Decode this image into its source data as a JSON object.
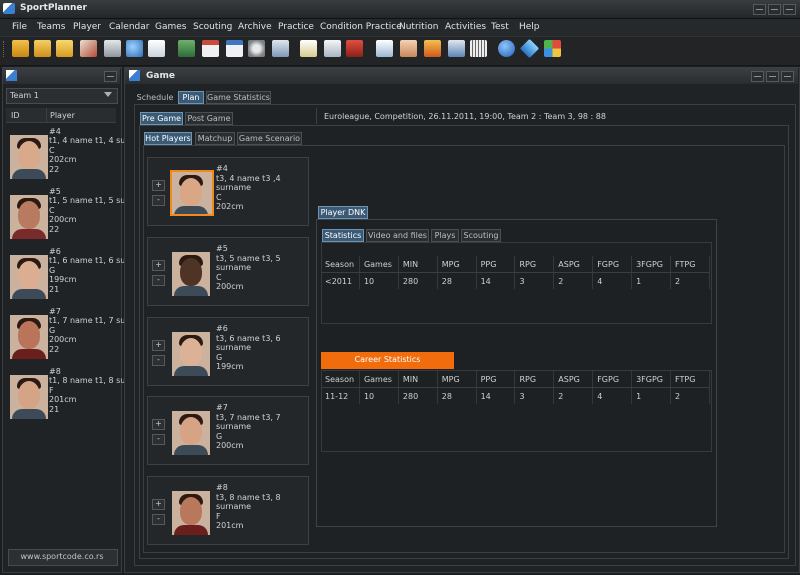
{
  "app": {
    "title": "SportPlanner"
  },
  "menu": [
    "File",
    "Teams",
    "Player",
    "Calendar",
    "Games",
    "Scouting",
    "Archive",
    "Practice",
    "Condition Practice",
    "Nutrition",
    "Activities",
    "Test",
    "Help"
  ],
  "colors": {
    "accent": "#f06c0c",
    "selected_tab": "#3a5a75",
    "background": "#1b1d1e"
  },
  "toolbar_icons": [
    "open-folder-icon",
    "folder-icon",
    "folder-yellow-icon",
    "edit-icon",
    "print-icon",
    "preview-icon",
    "document-icon",
    "image-icon",
    "calendar-icon",
    "calendar-grid-icon",
    "bicycle-icon",
    "keyboard-icon",
    "notes-icon",
    "clipboard-icon",
    "list-icon",
    "checklist-icon",
    "hands-icon",
    "stats-icon",
    "pool-icon",
    "help-icon",
    "diamond-icon",
    "colors-icon"
  ],
  "left": {
    "team_selected": "Team 1",
    "col_id": "ID",
    "col_player": "Player",
    "players": [
      {
        "num": "#4",
        "name": "t1, 4 name t1, 4 su",
        "pos": "C",
        "height": "202cm",
        "age": "22"
      },
      {
        "num": "#5",
        "name": "t1, 5 name t1, 5 su",
        "pos": "C",
        "height": "200cm",
        "age": "22"
      },
      {
        "num": "#6",
        "name": "t1, 6 name t1, 6 su",
        "pos": "G",
        "height": "199cm",
        "age": "21"
      },
      {
        "num": "#7",
        "name": "t1, 7 name t1, 7 su",
        "pos": "G",
        "height": "200cm",
        "age": "22"
      },
      {
        "num": "#8",
        "name": "t1, 8 name t1, 8 su",
        "pos": "F",
        "height": "201cm",
        "age": "21"
      }
    ],
    "footer": "www.sportcode.co.rs"
  },
  "game": {
    "title": "Game",
    "tabs": [
      "Schedule",
      "Plan",
      "Game Statistics"
    ],
    "subtabs": [
      "Pre Game",
      "Post Game"
    ],
    "info": "Euroleague, Competition, 26.11.2011, 19:00, Team 2 :  Team 3, 98 : 88",
    "plan_tabs": [
      "Hot Players",
      "Matchup",
      "Game Scenario"
    ],
    "hot_players": [
      {
        "num": "#4",
        "name": "t3, 4 name t3 ,4",
        "surname": "surname",
        "pos": "C",
        "height": "202cm"
      },
      {
        "num": "#5",
        "name": "t3, 5 name t3, 5",
        "surname": "surname",
        "pos": "C",
        "height": "200cm"
      },
      {
        "num": "#6",
        "name": "t3, 6 name t3, 6",
        "surname": "surname",
        "pos": "G",
        "height": "199cm"
      },
      {
        "num": "#7",
        "name": "t3, 7 name t3, 7",
        "surname": "surname",
        "pos": "G",
        "height": "200cm"
      },
      {
        "num": "#8",
        "name": "t3, 8 name t3, 8",
        "surname": "surname",
        "pos": "F",
        "height": "201cm"
      }
    ],
    "detail": {
      "title": "Player DNK",
      "tabs": [
        "Statistics",
        "Video and files",
        "Plays",
        "Scouting"
      ],
      "columns": [
        "Season",
        "Games",
        "MIN",
        "MPG",
        "PPG",
        "RPG",
        "ASPG",
        "FGPG",
        "3FGPG",
        "FTPG"
      ],
      "season_row": [
        "<2011",
        "10",
        "280",
        "28",
        "14",
        "3",
        "2",
        "4",
        "1",
        "2"
      ],
      "career_label": "Career Statistics",
      "career_row": [
        "11-12",
        "10",
        "280",
        "28",
        "14",
        "3",
        "2",
        "4",
        "1",
        "2"
      ]
    }
  }
}
